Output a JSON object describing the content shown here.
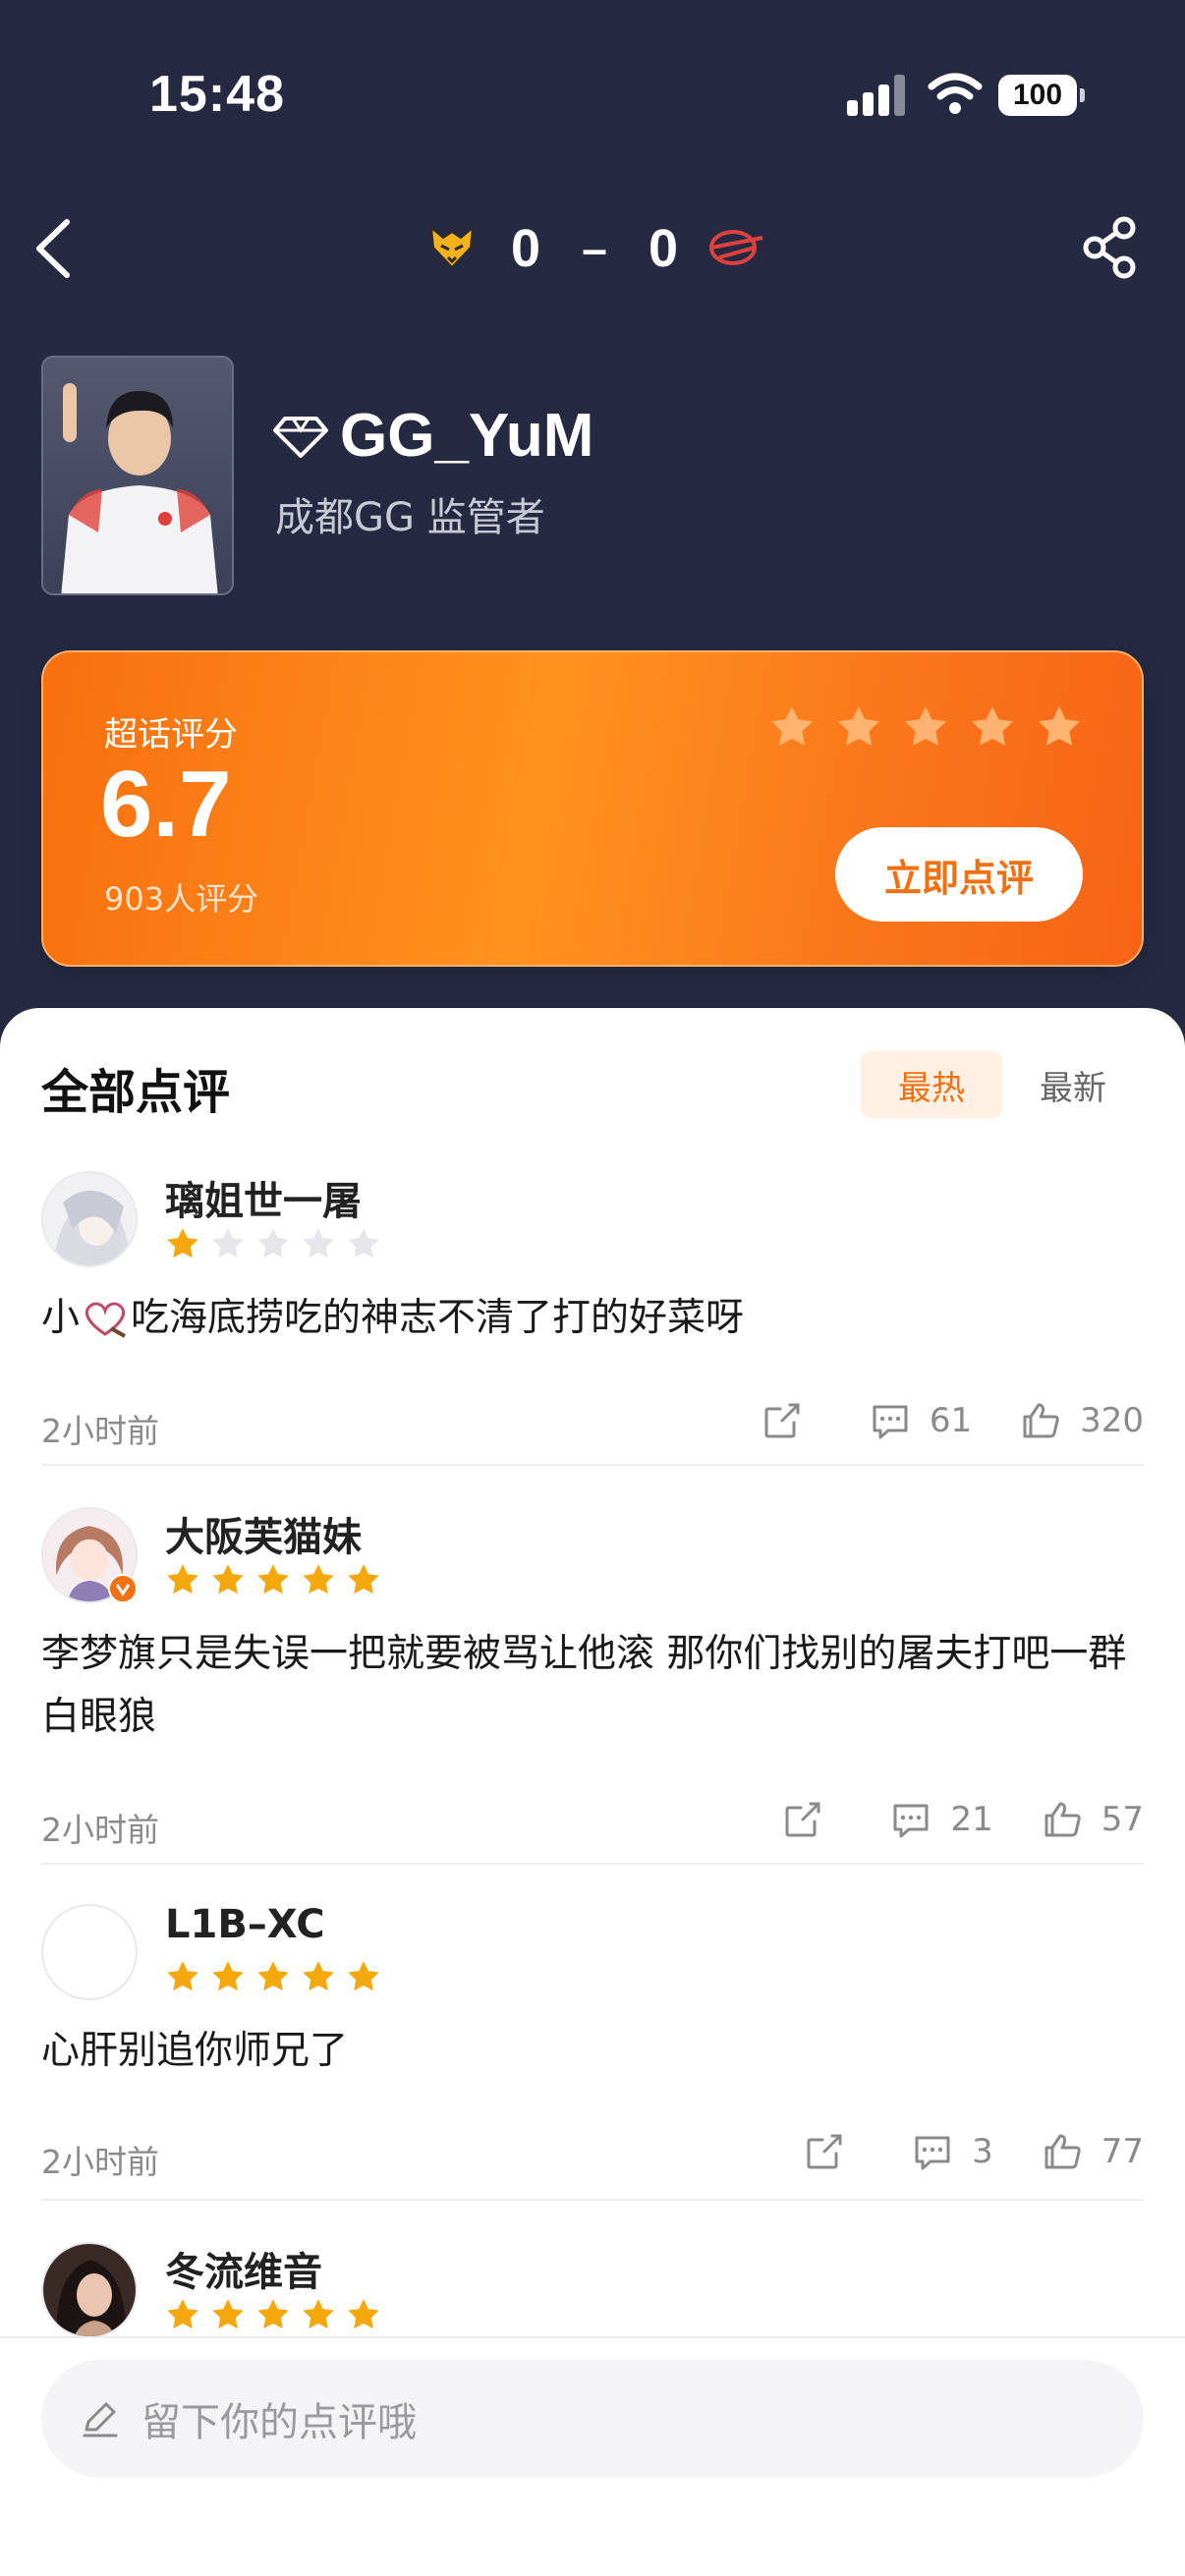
{
  "status_bar": {
    "time": "15:48",
    "battery": "100"
  },
  "match": {
    "score_home": "0",
    "score_dash": "–",
    "score_away": "0"
  },
  "player": {
    "name": "GG_YuM",
    "team_role": "成都GG 监管者"
  },
  "rating": {
    "label": "超话评分",
    "score": "6.7",
    "count": "903人评分",
    "button": "立即点评",
    "stars_shown": 5
  },
  "reviews_section": {
    "title": "全部点评",
    "tabs": [
      {
        "label": "最热",
        "active": true
      },
      {
        "label": "最新",
        "active": false
      }
    ]
  },
  "reviews": [
    {
      "user": "璃姐世一屠",
      "stars": 1,
      "text_pre": "小",
      "text_post": "吃海底捞吃的神志不清了打的好菜呀",
      "time": "2小时前",
      "comments": "61",
      "likes": "320"
    },
    {
      "user": "大阪芙猫妹",
      "stars": 5,
      "verified": true,
      "text": "李梦旗只是失误一把就要被骂让他滚 那你们找别的屠夫打吧一群白眼狼",
      "time": "2小时前",
      "comments": "21",
      "likes": "57"
    },
    {
      "user": "L1B–XC",
      "stars": 5,
      "text": "心肝别追你师兄了",
      "time": "2小时前",
      "comments": "3",
      "likes": "77"
    },
    {
      "user": "冬流维音",
      "stars": 5
    }
  ],
  "composer": {
    "placeholder": "留下你的点评哦"
  },
  "colors": {
    "accent": "#f2700f",
    "header_bg": "#252a42",
    "star": "#f5a80c",
    "star_empty": "#e6e6ea"
  }
}
